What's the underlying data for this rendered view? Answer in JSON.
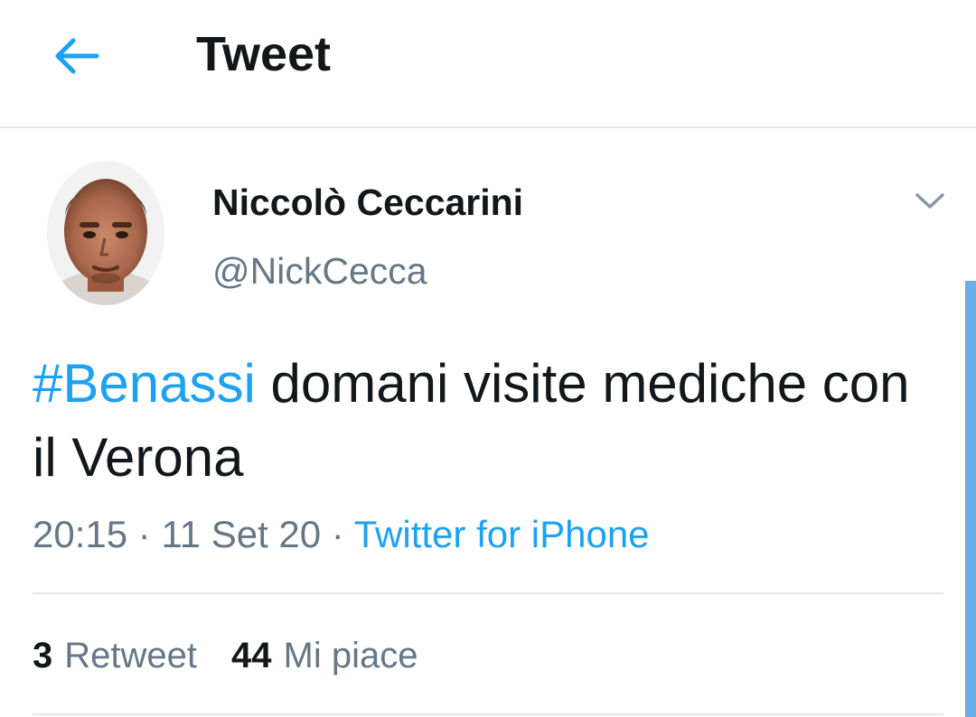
{
  "header": {
    "title": "Tweet",
    "back_icon": "arrow-left-icon"
  },
  "tweet": {
    "author": {
      "name": "Niccolò Ceccarini",
      "handle": "@NickCecca"
    },
    "text": {
      "hashtag": "#Benassi",
      "body": " domani visite mediche con il Verona"
    },
    "time": "20:15",
    "separator": " · ",
    "date": "11 Set 20",
    "source": "Twitter for iPhone",
    "stats": {
      "retweets_count": "3",
      "retweets_label": "Retweet",
      "likes_count": "44",
      "likes_label": "Mi piace"
    }
  },
  "colors": {
    "accent": "#1da1f2",
    "text_primary": "#14171a",
    "text_secondary": "#657786",
    "divider": "#e1e8ed"
  }
}
